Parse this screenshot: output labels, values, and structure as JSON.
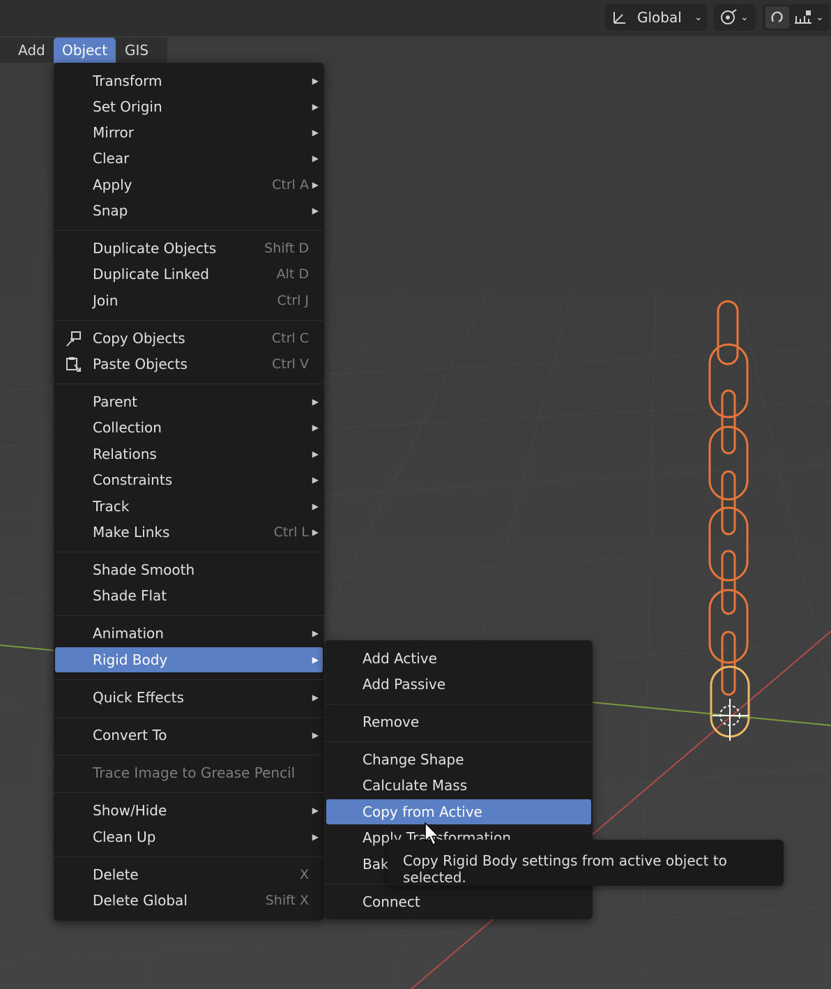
{
  "header": {
    "orientation_label": "Global",
    "icons": [
      "transform-orientation-icon",
      "pivot-icon",
      "snap-icon",
      "snap-increment-icon"
    ]
  },
  "menubar": {
    "items": [
      "Add",
      "Object",
      "GIS"
    ],
    "active": "Object"
  },
  "object_menu": {
    "items": [
      {
        "label": "Transform",
        "shortcut": "",
        "submenu": true
      },
      {
        "label": "Set Origin",
        "shortcut": "",
        "submenu": true
      },
      {
        "label": "Mirror",
        "shortcut": "",
        "submenu": true
      },
      {
        "label": "Clear",
        "shortcut": "",
        "submenu": true
      },
      {
        "label": "Apply",
        "shortcut": "Ctrl A",
        "submenu": true
      },
      {
        "label": "Snap",
        "shortcut": "",
        "submenu": true
      },
      {
        "label": "Duplicate Objects",
        "shortcut": "Shift D",
        "submenu": false
      },
      {
        "label": "Duplicate Linked",
        "shortcut": "Alt D",
        "submenu": false
      },
      {
        "label": "Join",
        "shortcut": "Ctrl J",
        "submenu": false
      },
      {
        "label": "Copy Objects",
        "shortcut": "Ctrl C",
        "submenu": false,
        "icon": "copy-icon"
      },
      {
        "label": "Paste Objects",
        "shortcut": "Ctrl V",
        "submenu": false,
        "icon": "paste-icon"
      },
      {
        "label": "Parent",
        "shortcut": "",
        "submenu": true
      },
      {
        "label": "Collection",
        "shortcut": "",
        "submenu": true
      },
      {
        "label": "Relations",
        "shortcut": "",
        "submenu": true
      },
      {
        "label": "Constraints",
        "shortcut": "",
        "submenu": true
      },
      {
        "label": "Track",
        "shortcut": "",
        "submenu": true
      },
      {
        "label": "Make Links",
        "shortcut": "Ctrl L",
        "submenu": true
      },
      {
        "label": "Shade Smooth",
        "shortcut": "",
        "submenu": false
      },
      {
        "label": "Shade Flat",
        "shortcut": "",
        "submenu": false
      },
      {
        "label": "Animation",
        "shortcut": "",
        "submenu": true
      },
      {
        "label": "Rigid Body",
        "shortcut": "",
        "submenu": true,
        "active": true
      },
      {
        "label": "Quick Effects",
        "shortcut": "",
        "submenu": true
      },
      {
        "label": "Convert To",
        "shortcut": "",
        "submenu": true
      },
      {
        "label": "Trace Image to Grease Pencil",
        "shortcut": "",
        "submenu": false,
        "disabled": true
      },
      {
        "label": "Show/Hide",
        "shortcut": "",
        "submenu": true
      },
      {
        "label": "Clean Up",
        "shortcut": "",
        "submenu": true
      },
      {
        "label": "Delete",
        "shortcut": "X",
        "submenu": false
      },
      {
        "label": "Delete Global",
        "shortcut": "Shift X",
        "submenu": false
      }
    ]
  },
  "rigid_body_menu": {
    "items": [
      {
        "label": "Add Active"
      },
      {
        "label": "Add Passive"
      },
      {
        "label": "Remove"
      },
      {
        "label": "Change Shape"
      },
      {
        "label": "Calculate Mass"
      },
      {
        "label": "Copy from Active",
        "active": true
      },
      {
        "label": "Apply Transformation"
      },
      {
        "label": "Bake To Keyframes"
      },
      {
        "label": "Connect"
      }
    ]
  },
  "tooltip": {
    "text": "Copy Rigid Body settings from active object to selected."
  },
  "colors": {
    "menu_bg": "#1c1c1c",
    "highlight": "#5b7fc4",
    "selection_outline": "#e8763a",
    "x_axis": "#b54a4a",
    "y_axis": "#7a9a3c"
  }
}
